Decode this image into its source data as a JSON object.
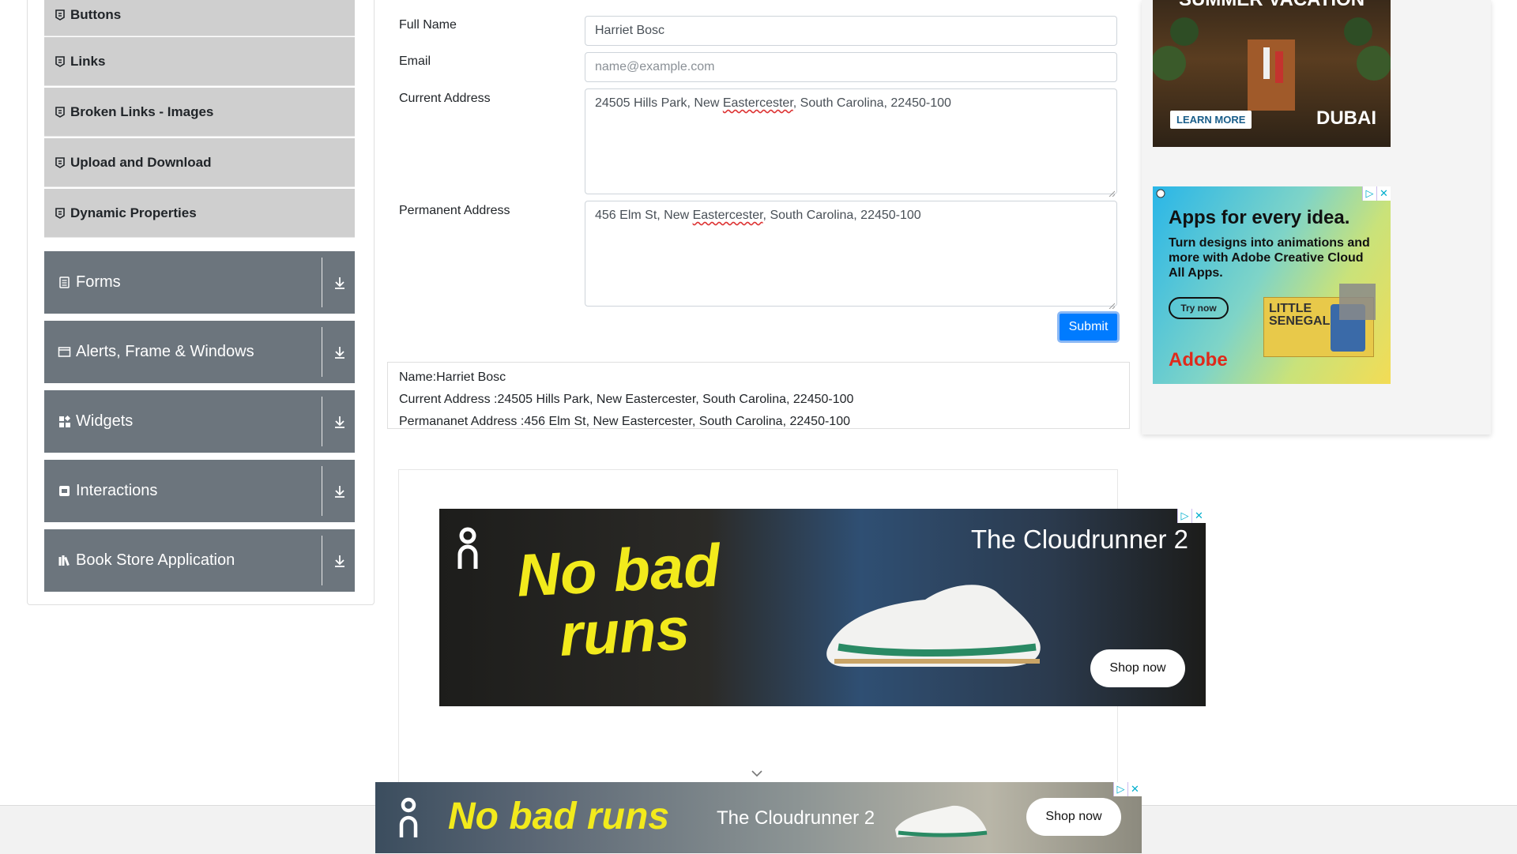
{
  "sidebar": {
    "elements_items": [
      {
        "label": "Buttons"
      },
      {
        "label": "Links"
      },
      {
        "label": "Broken Links - Images"
      },
      {
        "label": "Upload and Download"
      },
      {
        "label": "Dynamic Properties"
      }
    ],
    "groups": [
      {
        "label": "Forms",
        "icon": "form-icon"
      },
      {
        "label": "Alerts, Frame & Windows",
        "icon": "window-icon"
      },
      {
        "label": "Widgets",
        "icon": "widgets-icon"
      },
      {
        "label": "Interactions",
        "icon": "interactions-icon"
      },
      {
        "label": "Book Store Application",
        "icon": "books-icon"
      }
    ]
  },
  "form": {
    "full_name": {
      "label": "Full Name",
      "value": "Harriet Bosc"
    },
    "email": {
      "label": "Email",
      "placeholder": "name@example.com"
    },
    "current_address": {
      "label": "Current Address",
      "value_pre": "24505 Hills Park, New ",
      "value_flag": "Eastercester",
      "value_post": ", South Carolina, 22450-100"
    },
    "permanent_address": {
      "label": "Permanent Address",
      "value_pre": "456 Elm St, New ",
      "value_flag": "Eastercester",
      "value_post": ", South Carolina, 22450-100"
    },
    "submit_label": "Submit"
  },
  "output": {
    "name": "Name:Harriet Bosc",
    "current_address": "Current Address :24505 Hills Park, New Eastercester, South Carolina, 22450-100",
    "permanent_address": "Permananet Address :456 Elm St, New Eastercester, South Carolina, 22450-100"
  },
  "ads": {
    "main_banner": {
      "headline_1": "No bad",
      "headline_2": "runs",
      "product": "The Cloudrunner 2",
      "cta": "Shop now"
    },
    "dubai": {
      "top_text": "SUMMER VACATION",
      "cta": "LEARN MORE",
      "brand": "DUBAI"
    },
    "adobe": {
      "headline": "Apps for every idea.",
      "body": "Turn designs into animations and more with Adobe Creative Cloud All Apps.",
      "cta": "Try now",
      "poster": "LITTLE SENEGAL",
      "brand": "Adobe"
    },
    "bottom_banner": {
      "headline": "No bad runs",
      "product": "The Cloudrunner 2",
      "cta": "Shop now"
    }
  },
  "colors": {
    "sidebar_group": "#6c757d",
    "sidebar_item": "#cfcfcf",
    "submit": "#007bff",
    "on_yellow": "#f2ea1c"
  }
}
